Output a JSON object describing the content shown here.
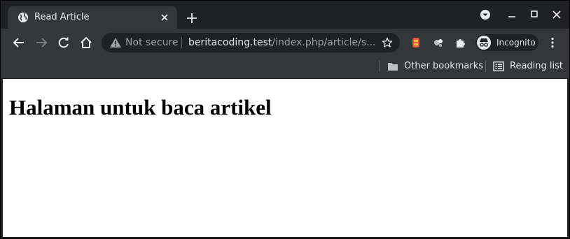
{
  "tab": {
    "title": "Read Article",
    "favicon": "globe-icon"
  },
  "toolbar": {
    "security_label": "Not secure",
    "url_host": "beritacoding.test",
    "url_path": "/index.php/article/s...",
    "profile_label": "Incognito"
  },
  "bookmarks": {
    "other_label": "Other bookmarks",
    "reading_list_label": "Reading list"
  },
  "page": {
    "heading": "Halaman untuk baca artikel"
  },
  "colors": {
    "frame": "#202124",
    "toolbar": "#35363a",
    "text": "#e8eaed",
    "muted": "#9aa0a6"
  }
}
